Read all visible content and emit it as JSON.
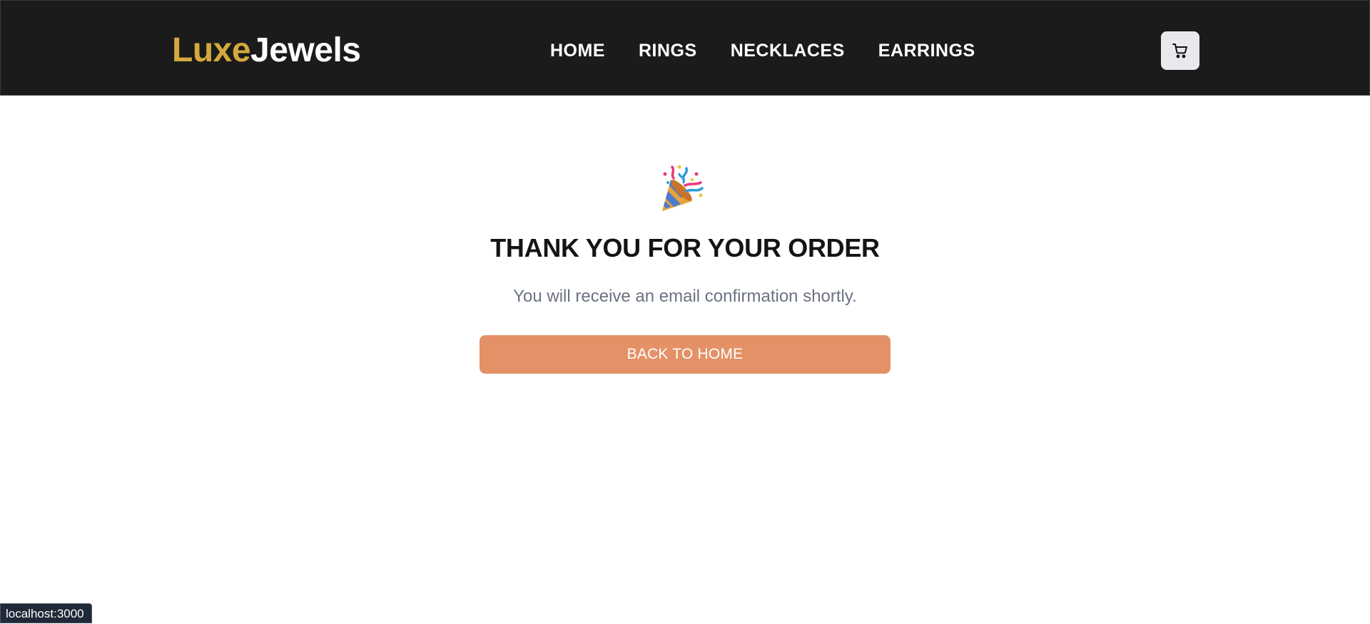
{
  "header": {
    "logo_part1": "Luxe",
    "logo_part2": "Jewels",
    "nav": [
      {
        "label": "HOME"
      },
      {
        "label": "RINGS"
      },
      {
        "label": "NECKLACES"
      },
      {
        "label": "EARRINGS"
      }
    ],
    "cart_icon": "shopping-cart-icon"
  },
  "confirmation": {
    "icon": "party-popper-icon",
    "title": "THANK YOU FOR YOUR ORDER",
    "message": "You will receive an email confirmation shortly.",
    "button_label": "BACK TO HOME"
  },
  "status_bar": {
    "url": "localhost:3000"
  },
  "colors": {
    "header_bg": "#1b1b1b",
    "logo_accent": "#d4a93c",
    "button_bg": "#e49167",
    "subtext": "#6b7280"
  }
}
